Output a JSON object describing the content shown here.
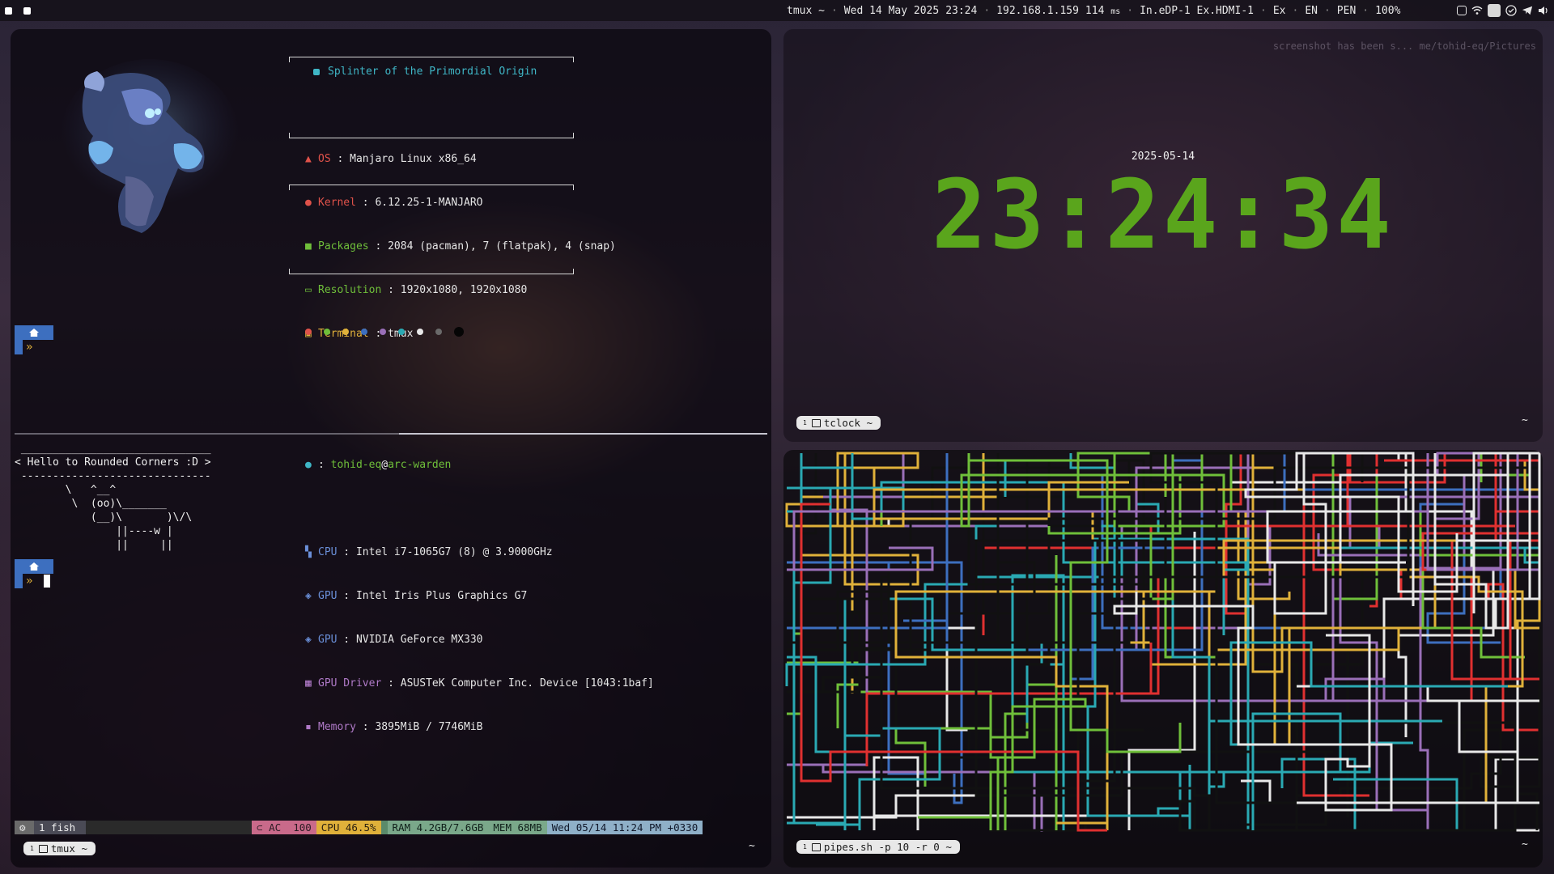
{
  "topbar": {
    "tmux": "tmux ~",
    "date": "Wed 14 May 2025",
    "time": "23:24",
    "ip": "192.168.1.159",
    "latency": "114",
    "latency_unit": "ms",
    "displays": "In.eDP-1 Ex.HDMI-1",
    "ex": "Ex",
    "lang": "EN",
    "pen": "PEN",
    "battery": "100%",
    "icons": [
      "clipboard-icon",
      "wifi-icon",
      "app-icon",
      "check-icon",
      "volume-icon",
      "telegram-icon"
    ]
  },
  "fastfetch": {
    "title": "Splinter of the Primordial Origin",
    "rows": [
      {
        "key": "OS",
        "value": "Manjaro Linux x86_64",
        "color": "#e0524a"
      },
      {
        "key": "Kernel",
        "value": "6.12.25-1-MANJARO",
        "color": "#e0524a"
      },
      {
        "key": "Packages",
        "value": "2084 (pacman), 7 (flatpak), 4 (snap)",
        "color": "#6fbf3a"
      },
      {
        "key": "Resolution",
        "value": "1920x1080, 1920x1080",
        "color": "#6fbf3a"
      },
      {
        "key": "Terminal",
        "value": "tmux",
        "color": "#e0b13a"
      }
    ],
    "user": "tohid-eq",
    "at": "@",
    "host": "arc-warden",
    "hw_rows": [
      {
        "key": "CPU",
        "value": "Intel i7-1065G7 (8) @ 3.9000GHz",
        "color": "#6a8fd8"
      },
      {
        "key": "GPU",
        "value": "Intel Iris Plus Graphics G7",
        "color": "#6a8fd8"
      },
      {
        "key": "GPU",
        "value": "NVIDIA GeForce MX330",
        "color": "#6a8fd8"
      },
      {
        "key": "GPU Driver",
        "value": "ASUSTeK Computer Inc. Device [1043:1baf]",
        "color": "#b07ac8"
      },
      {
        "key": "Memory",
        "value": "3895MiB / 7746MiB",
        "color": "#b07ac8"
      }
    ],
    "palette": [
      "#e0524a",
      "#6fbf3a",
      "#e0b13a",
      "#3d6fbf",
      "#9a6fb8",
      "#2aa9b3",
      "#e8e8e8",
      "#6a6a6a",
      "#050505"
    ]
  },
  "cowsay": {
    "top": " ______________________________",
    "text": "< Hello to Rounded Corners :D >",
    "bottom": " ------------------------------",
    "cow": "        \\   ^__^\n         \\  (oo)\\_______\n            (__)\\       )\\/\\\n                ||----w |\n                ||     ||"
  },
  "tmux_left": {
    "session_icon": "⚙",
    "window": "1 fish",
    "ac": "AC",
    "ac_val": "100",
    "cpu": "CPU 46.5%",
    "ram": "RAM 4.2GB/7.6GB",
    "mem": "MEM 68MB",
    "datetime": "Wed 05/14 11:24 PM +0330",
    "tab_num": "1",
    "tab_label": "tmux ~",
    "tilde": "~"
  },
  "clock_pane": {
    "date": "2025-05-14",
    "time": "23:24:34",
    "notification": "screenshot has been s... me/tohid-eq/Pictures",
    "tab_num": "1",
    "tab_label": "tclock ~",
    "tilde": "~"
  },
  "pipes_pane": {
    "tab_num": "1",
    "tab_label": "pipes.sh -p 10 -r 0 ~",
    "tilde": "~",
    "colors": [
      "#e0b13a",
      "#2aa9b3",
      "#e8e8e8",
      "#3d6fbf",
      "#e03030",
      "#6fbf3a",
      "#9a6fb8",
      "#111111"
    ]
  }
}
